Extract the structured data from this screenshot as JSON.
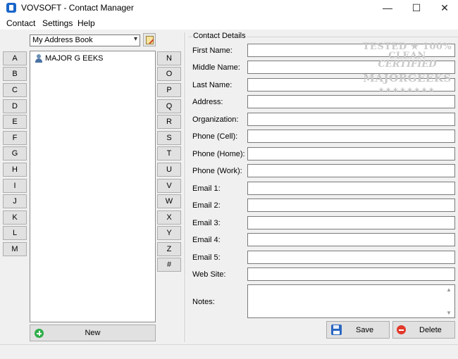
{
  "window": {
    "title": "VOVSOFT - Contact Manager",
    "minimize_glyph": "—",
    "maximize_glyph": "☐",
    "close_glyph": "✕"
  },
  "menu": {
    "items": [
      "Contact",
      "Settings",
      "Help"
    ]
  },
  "address_book": {
    "selected": "My Address Book",
    "dropdown_glyph": "▾"
  },
  "letters_left": [
    "A",
    "B",
    "C",
    "D",
    "E",
    "F",
    "G",
    "H",
    "I",
    "J",
    "K",
    "L",
    "M"
  ],
  "letters_right": [
    "N",
    "O",
    "P",
    "Q",
    "R",
    "S",
    "T",
    "U",
    "V",
    "W",
    "X",
    "Y",
    "Z",
    "#"
  ],
  "contacts": [
    {
      "name": "MAJOR G EEKS",
      "icon": "person-icon"
    }
  ],
  "new_button": {
    "label": "New",
    "icon": "plus-icon"
  },
  "details": {
    "group_title": "Contact Details",
    "fields": [
      {
        "label": "First Name:",
        "value": ""
      },
      {
        "label": "Middle Name:",
        "value": ""
      },
      {
        "label": "Last Name:",
        "value": ""
      },
      {
        "label": "Address:",
        "value": ""
      },
      {
        "label": "Organization:",
        "value": ""
      },
      {
        "label": "Phone (Cell):",
        "value": ""
      },
      {
        "label": "Phone (Home):",
        "value": ""
      },
      {
        "label": "Phone (Work):",
        "value": ""
      },
      {
        "label": "Email 1:",
        "value": ""
      },
      {
        "label": "Email 2:",
        "value": ""
      },
      {
        "label": "Email 3:",
        "value": ""
      },
      {
        "label": "Email 4:",
        "value": ""
      },
      {
        "label": "Email 5:",
        "value": ""
      },
      {
        "label": "Web Site:",
        "value": ""
      }
    ],
    "notes_label": "Notes:",
    "notes_value": ""
  },
  "actions": {
    "save_label": "Save",
    "delete_label": "Delete"
  },
  "watermark": {
    "line1": "TESTED ★ 100% CLEAN",
    "line2": "CERTIFIED",
    "line3": "MAJORGEEKS",
    "stars": "★★★★★★★★"
  },
  "colors": {
    "accent_blue": "#1a66c9",
    "new_green": "#2fae4a",
    "delete_red": "#e2392b",
    "window_bg": "#f0f0f0"
  }
}
